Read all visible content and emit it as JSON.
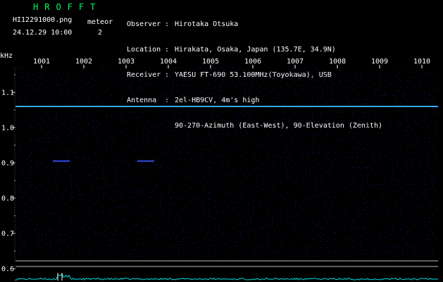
{
  "header": {
    "logo": "HROFFT",
    "filename": "HI12291000.png",
    "timestamp": "24.12.29 10:00",
    "meteor_label": "meteor",
    "meteor_count": "2"
  },
  "info": [
    {
      "key": "Observer",
      "value": "Hirotaka Otsuka"
    },
    {
      "key": "Location",
      "value": "Hirakata, Osaka, Japan (135.7E, 34.9N)"
    },
    {
      "key": "Receiver",
      "value": "YAESU FT-690 53.100MHz(Toyokawa), USB"
    },
    {
      "key": "Antenna",
      "value": "2el-HB9CV, 4m's high"
    },
    {
      "key": "",
      "value": "90-270-Azimuth (East-West), 90-Elevation (Zenith)"
    }
  ],
  "colors": {
    "background": "#000000",
    "logo": "#00ff66",
    "carrier_line": "#33aaff",
    "noise": "#1a1f8a",
    "level_trace": "#00dddd"
  },
  "chart_data": {
    "type": "heatmap",
    "y_unit": "kHz",
    "x_ticks": [
      "1001",
      "1002",
      "1003",
      "1004",
      "1005",
      "1006",
      "1007",
      "1008",
      "1009",
      "1010"
    ],
    "y_ticks": [
      "1.1",
      "1.0",
      "0.9",
      "0.8",
      "0.7",
      "0.6"
    ],
    "ylim": [
      0.58,
      1.18
    ],
    "carrier_frequency_khz": 1.06,
    "meteor_echoes": [
      {
        "label": "meteor-1",
        "x_second": 1001.3,
        "freq_khz": 0.905
      },
      {
        "label": "meteor-2",
        "x_second": 1003.3,
        "freq_khz": 0.905
      }
    ]
  }
}
